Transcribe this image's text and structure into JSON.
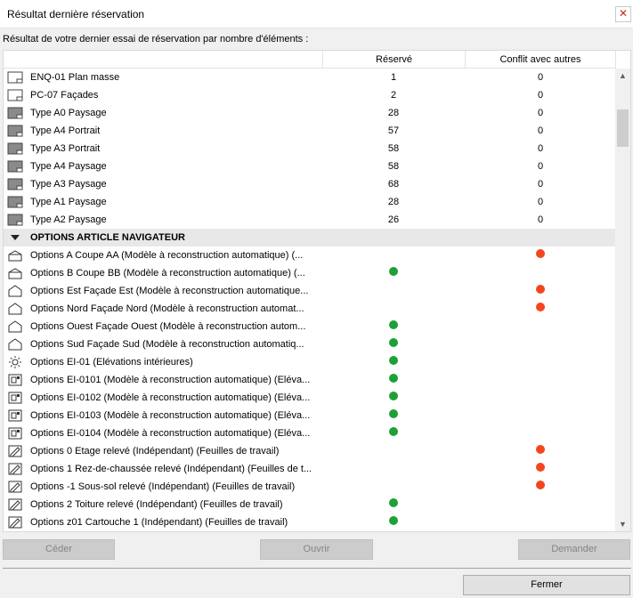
{
  "window": {
    "title": "Résultat dernière réservation",
    "close_glyph": "✕"
  },
  "intro": "Résultat de votre dernier essai de réservation par nombre d'éléments :",
  "columns": {
    "name": "",
    "reserved": "Réservé",
    "conflict": "Conflit avec autres"
  },
  "rows": [
    {
      "kind": "item",
      "icon": "layout-sheet-icon",
      "name": "ENQ-01 Plan masse",
      "reserved": "1",
      "conflict": "0"
    },
    {
      "kind": "item",
      "icon": "layout-sheet-icon",
      "name": "PC-07 Façades",
      "reserved": "2",
      "conflict": "0"
    },
    {
      "kind": "item",
      "icon": "master-layout-icon",
      "name": "Type A0 Paysage",
      "reserved": "28",
      "conflict": "0"
    },
    {
      "kind": "item",
      "icon": "master-layout-icon",
      "name": "Type A4 Portrait",
      "reserved": "57",
      "conflict": "0"
    },
    {
      "kind": "item",
      "icon": "master-layout-icon",
      "name": "Type A3 Portrait",
      "reserved": "58",
      "conflict": "0"
    },
    {
      "kind": "item",
      "icon": "master-layout-icon",
      "name": "Type A4 Paysage",
      "reserved": "58",
      "conflict": "0"
    },
    {
      "kind": "item",
      "icon": "master-layout-icon",
      "name": "Type A3 Paysage",
      "reserved": "68",
      "conflict": "0"
    },
    {
      "kind": "item",
      "icon": "master-layout-icon",
      "name": "Type A1 Paysage",
      "reserved": "28",
      "conflict": "0"
    },
    {
      "kind": "item",
      "icon": "master-layout-icon",
      "name": "Type A2 Paysage",
      "reserved": "26",
      "conflict": "0"
    },
    {
      "kind": "group",
      "icon": "expand-arrow-icon",
      "name": "OPTIONS ARTICLE NAVIGATEUR"
    },
    {
      "kind": "item",
      "icon": "section-icon",
      "name": "Options A Coupe AA (Modèle à reconstruction automatique) (...",
      "status": "red"
    },
    {
      "kind": "item",
      "icon": "section-icon",
      "name": "Options B Coupe BB (Modèle à reconstruction automatique) (...",
      "status": "green"
    },
    {
      "kind": "item",
      "icon": "elevation-icon",
      "name": "Options Est Façade Est (Modèle à reconstruction automatique...",
      "status": "red"
    },
    {
      "kind": "item",
      "icon": "elevation-icon",
      "name": "Options Nord Façade Nord (Modèle à reconstruction automat...",
      "status": "red"
    },
    {
      "kind": "item",
      "icon": "elevation-icon",
      "name": "Options Ouest Façade Ouest (Modèle à reconstruction autom...",
      "status": "green"
    },
    {
      "kind": "item",
      "icon": "elevation-icon",
      "name": "Options Sud Façade Sud (Modèle à reconstruction automatiq...",
      "status": "green"
    },
    {
      "kind": "item",
      "icon": "interior-elevation-icon",
      "name": "Options EI-01 (Elévations intérieures)",
      "status": "green"
    },
    {
      "kind": "item",
      "icon": "interior-view-icon",
      "name": "Options EI-0101 (Modèle à reconstruction automatique) (Eléva...",
      "status": "green"
    },
    {
      "kind": "item",
      "icon": "interior-view-icon",
      "name": "Options EI-0102 (Modèle à reconstruction automatique) (Eléva...",
      "status": "green"
    },
    {
      "kind": "item",
      "icon": "interior-view-icon",
      "name": "Options EI-0103 (Modèle à reconstruction automatique) (Eléva...",
      "status": "green"
    },
    {
      "kind": "item",
      "icon": "interior-view-icon",
      "name": "Options EI-0104 (Modèle à reconstruction automatique) (Eléva...",
      "status": "green"
    },
    {
      "kind": "item",
      "icon": "worksheet-icon",
      "name": "Options 0 Etage relevé (Indépendant) (Feuilles de travail)",
      "status": "red"
    },
    {
      "kind": "item",
      "icon": "worksheet-icon",
      "name": "Options 1 Rez-de-chaussée relevé (Indépendant) (Feuilles de t...",
      "status": "red"
    },
    {
      "kind": "item",
      "icon": "worksheet-icon",
      "name": "Options -1 Sous-sol relevé (Indépendant) (Feuilles de travail)",
      "status": "red"
    },
    {
      "kind": "item",
      "icon": "worksheet-icon",
      "name": "Options 2 Toiture relevé (Indépendant) (Feuilles de travail)",
      "status": "green"
    },
    {
      "kind": "item",
      "icon": "worksheet-icon",
      "name": "Options z01 Cartouche 1 (Indépendant) (Feuilles de travail)",
      "status": "green"
    }
  ],
  "status_colors": {
    "green": "#1fa037",
    "red": "#f3461d"
  },
  "buttons": {
    "ceder": "Céder",
    "ouvrir": "Ouvrir",
    "demander": "Demander",
    "fermer": "Fermer"
  }
}
